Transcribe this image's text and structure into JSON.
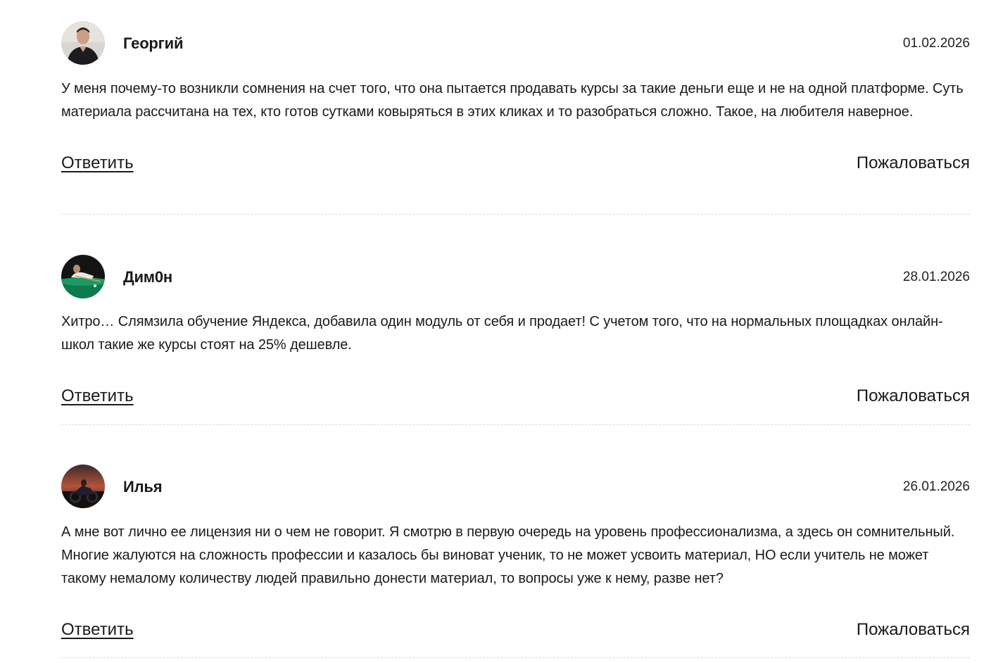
{
  "comments": [
    {
      "author": "Георгий",
      "date": "01.02.2026",
      "avatar_icon": "user-photo-man-dark-shirt",
      "text": "У меня почему-то возникли сомнения на счет того, что она пытается продавать курсы за такие деньги еще и не на одной платформе. Суть материала рассчитана на тех, кто готов сутками ковыряться в этих кликах и то разобраться сложно. Такое, на любителя наверное.",
      "reply_label": "Ответить",
      "report_label": "Пожаловаться"
    },
    {
      "author": "Дим0н",
      "date": "28.01.2026",
      "avatar_icon": "user-photo-billiards",
      "text": "Хитро… Слямзила обучение Яндекса, добавила один модуль от себя и продает! С учетом того, что на нормальных площадках онлайн-школ такие же курсы стоят на 25% дешевле.",
      "reply_label": "Ответить",
      "report_label": "Пожаловаться"
    },
    {
      "author": "Илья",
      "date": "26.01.2026",
      "avatar_icon": "user-photo-motorcycle-sunset",
      "text": "А мне вот лично ее лицензия ни о чем не говорит. Я смотрю в первую очередь на уровень профессионализма, а здесь он сомнительный. Многие жалуются на сложность профессии и казалось бы виноват ученик, то не может усвоить материал, НО если учитель не может такому немалому количеству людей правильно донести материал, то вопросы уже к нему, разве нет?",
      "reply_label": "Ответить",
      "report_label": "Пожаловаться"
    }
  ]
}
